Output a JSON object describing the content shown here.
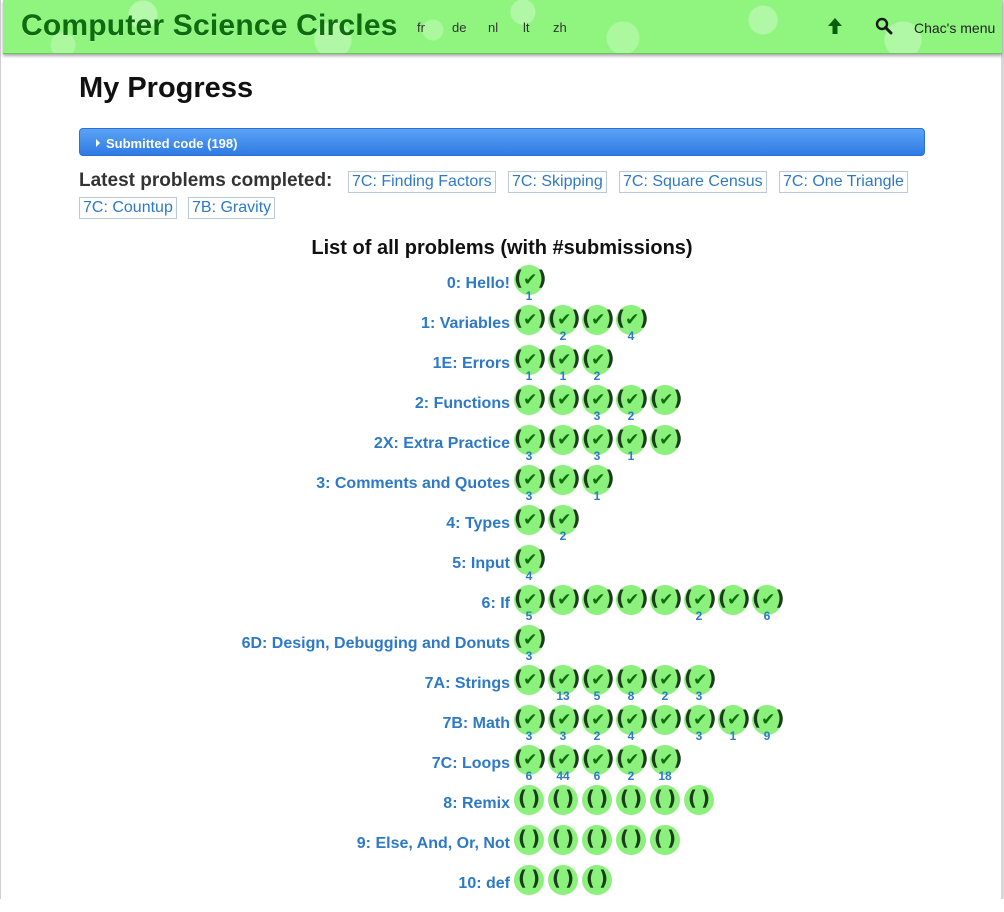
{
  "header": {
    "site_title": "Computer Science Circles",
    "languages": [
      "fr",
      "de",
      "nl",
      "lt",
      "zh"
    ],
    "menu_label": "Chac's menu",
    "colors": {
      "background": "#8ff57f",
      "title": "#0e6b0e",
      "icon": "#0a5e0a"
    }
  },
  "page": {
    "title": "My Progress",
    "submitted_label": "Submitted code (198)",
    "latest_label": "Latest problems completed:",
    "latest_problems": [
      "7C: Finding Factors",
      "7C: Skipping",
      "7C: Square Census",
      "7C: One Triangle",
      "7C: Countup",
      "7B: Gravity"
    ],
    "list_heading": "List of all problems (with #submissions)"
  },
  "problem_status_icons": {
    "done": "checkmark-in-parens-icon",
    "not_done": "empty-parens-icon"
  },
  "lessons": [
    {
      "label": "0: Hello!",
      "problems": [
        {
          "done": true,
          "count": "1"
        }
      ]
    },
    {
      "label": "1: Variables",
      "problems": [
        {
          "done": true,
          "count": ""
        },
        {
          "done": true,
          "count": "2"
        },
        {
          "done": true,
          "count": ""
        },
        {
          "done": true,
          "count": "4"
        }
      ]
    },
    {
      "label": "1E: Errors",
      "problems": [
        {
          "done": true,
          "count": "1"
        },
        {
          "done": true,
          "count": "1"
        },
        {
          "done": true,
          "count": "2"
        }
      ]
    },
    {
      "label": "2: Functions",
      "problems": [
        {
          "done": true,
          "count": ""
        },
        {
          "done": true,
          "count": ""
        },
        {
          "done": true,
          "count": "3"
        },
        {
          "done": true,
          "count": "2"
        },
        {
          "done": true,
          "count": ""
        }
      ]
    },
    {
      "label": "2X: Extra Practice",
      "problems": [
        {
          "done": true,
          "count": "3"
        },
        {
          "done": true,
          "count": ""
        },
        {
          "done": true,
          "count": "3"
        },
        {
          "done": true,
          "count": "1"
        },
        {
          "done": true,
          "count": ""
        }
      ]
    },
    {
      "label": "3: Comments and Quotes",
      "problems": [
        {
          "done": true,
          "count": "3"
        },
        {
          "done": true,
          "count": ""
        },
        {
          "done": true,
          "count": "1"
        }
      ]
    },
    {
      "label": "4: Types",
      "problems": [
        {
          "done": true,
          "count": ""
        },
        {
          "done": true,
          "count": "2"
        }
      ]
    },
    {
      "label": "5: Input",
      "problems": [
        {
          "done": true,
          "count": "4"
        }
      ]
    },
    {
      "label": "6: If",
      "problems": [
        {
          "done": true,
          "count": "5"
        },
        {
          "done": true,
          "count": ""
        },
        {
          "done": true,
          "count": ""
        },
        {
          "done": true,
          "count": ""
        },
        {
          "done": true,
          "count": ""
        },
        {
          "done": true,
          "count": "2"
        },
        {
          "done": true,
          "count": ""
        },
        {
          "done": true,
          "count": "6"
        }
      ]
    },
    {
      "label": "6D: Design, Debugging and Donuts",
      "problems": [
        {
          "done": true,
          "count": "3"
        }
      ]
    },
    {
      "label": "7A: Strings",
      "problems": [
        {
          "done": true,
          "count": ""
        },
        {
          "done": true,
          "count": "13"
        },
        {
          "done": true,
          "count": "5"
        },
        {
          "done": true,
          "count": "8"
        },
        {
          "done": true,
          "count": "2"
        },
        {
          "done": true,
          "count": "3"
        }
      ]
    },
    {
      "label": "7B: Math",
      "problems": [
        {
          "done": true,
          "count": "3"
        },
        {
          "done": true,
          "count": "3"
        },
        {
          "done": true,
          "count": "2"
        },
        {
          "done": true,
          "count": "4"
        },
        {
          "done": true,
          "count": ""
        },
        {
          "done": true,
          "count": "3"
        },
        {
          "done": true,
          "count": "1"
        },
        {
          "done": true,
          "count": "9"
        }
      ]
    },
    {
      "label": "7C: Loops",
      "problems": [
        {
          "done": true,
          "count": "6"
        },
        {
          "done": true,
          "count": "44"
        },
        {
          "done": true,
          "count": "6"
        },
        {
          "done": true,
          "count": "2"
        },
        {
          "done": true,
          "count": "18"
        }
      ]
    },
    {
      "label": "8: Remix",
      "problems": [
        {
          "done": false,
          "count": ""
        },
        {
          "done": false,
          "count": ""
        },
        {
          "done": false,
          "count": ""
        },
        {
          "done": false,
          "count": ""
        },
        {
          "done": false,
          "count": ""
        },
        {
          "done": false,
          "count": ""
        }
      ]
    },
    {
      "label": "9: Else, And, Or, Not",
      "problems": [
        {
          "done": false,
          "count": ""
        },
        {
          "done": false,
          "count": ""
        },
        {
          "done": false,
          "count": ""
        },
        {
          "done": false,
          "count": ""
        },
        {
          "done": false,
          "count": ""
        }
      ]
    },
    {
      "label": "10: def",
      "problems": [
        {
          "done": false,
          "count": ""
        },
        {
          "done": false,
          "count": ""
        },
        {
          "done": false,
          "count": ""
        }
      ]
    }
  ]
}
